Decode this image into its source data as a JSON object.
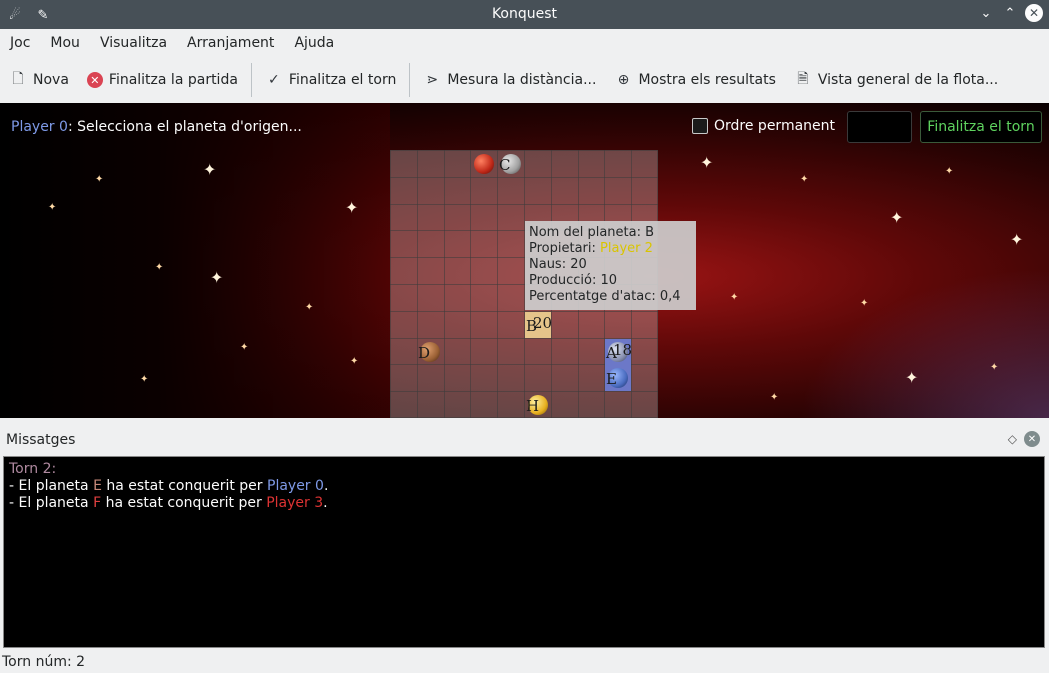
{
  "window": {
    "title": "Konquest"
  },
  "menu": [
    "Joc",
    "Mou",
    "Visualitza",
    "Arranjament",
    "Ajuda"
  ],
  "toolbar": {
    "new": "Nova",
    "end_game": "Finalitza la partida",
    "end_turn": "Finalitza el torn",
    "measure": "Mesura la distància...",
    "results": "Mostra els resultats",
    "fleet": "Vista general de la flota..."
  },
  "game_header": {
    "player": "Player 0",
    "instruction": ": Selecciona el planeta d'origen...",
    "permanent_order": "Ordre permanent",
    "ships_input_value": "",
    "end_turn_button": "Finalitza el torn"
  },
  "map": {
    "planets": [
      {
        "name": "",
        "ships": "",
        "color": "#c02818"
      },
      {
        "name": "C",
        "ships": "",
        "color": "#a0a0a0"
      },
      {
        "name": "B",
        "ships": "20",
        "color": "#d9b070"
      },
      {
        "name": "D",
        "ships": "",
        "color": "#9a6034"
      },
      {
        "name": "A",
        "ships": "18",
        "color": "#7b86c9"
      },
      {
        "name": "E",
        "ships": "",
        "color": "#4a6cc0"
      },
      {
        "name": "H",
        "ships": "",
        "color": "#e8b020"
      }
    ]
  },
  "tooltip": {
    "name_line": "Nom del planeta: B",
    "owner_label": "Propietari: ",
    "owner_value": "Player 2",
    "ships_line": "Naus: 20",
    "production_line": "Producció: 10",
    "attack_line": "Percentatge d'atac: 0,4"
  },
  "messages": {
    "title": "Missatges",
    "turn_line": "Torn 2:",
    "line1": {
      "a": "- El planeta ",
      "planet": "E",
      "b": " ha estat conquerit per ",
      "player": "Player 0",
      "c": "."
    },
    "line2": {
      "a": "- El planeta ",
      "planet": "F",
      "b": " ha estat conquerit per ",
      "player": "Player 3",
      "c": "."
    }
  },
  "statusbar": {
    "turn": "Torn núm: 2"
  }
}
